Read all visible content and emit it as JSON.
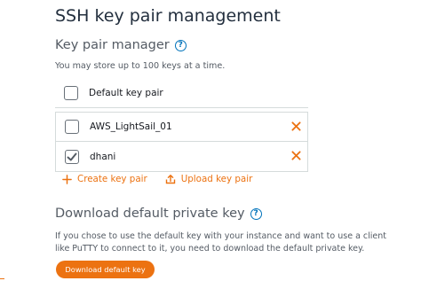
{
  "page": {
    "title": "SSH key pair management"
  },
  "key_pair_manager": {
    "heading": "Key pair manager",
    "help_icon": "question-circle-icon",
    "note": "You may store up to 100 keys at a time.",
    "keys": [
      {
        "label": "Default key pair",
        "checked": false,
        "deletable": false
      },
      {
        "label": "AWS_LightSail_01",
        "checked": false,
        "deletable": true
      },
      {
        "label": "dhani",
        "checked": true,
        "deletable": true
      }
    ],
    "create_label": "Create key pair",
    "upload_label": "Upload key pair"
  },
  "download": {
    "heading": "Download default private key",
    "paragraph": "If you chose to use the default key with your instance and want to use a client like PuTTY to connect to it, you need to download the default private key.",
    "button_label": "Download default key"
  },
  "colors": {
    "accent": "#ec7211",
    "link_blue": "#0073bb",
    "text": "#232f3e",
    "border": "#d5dbdb"
  }
}
